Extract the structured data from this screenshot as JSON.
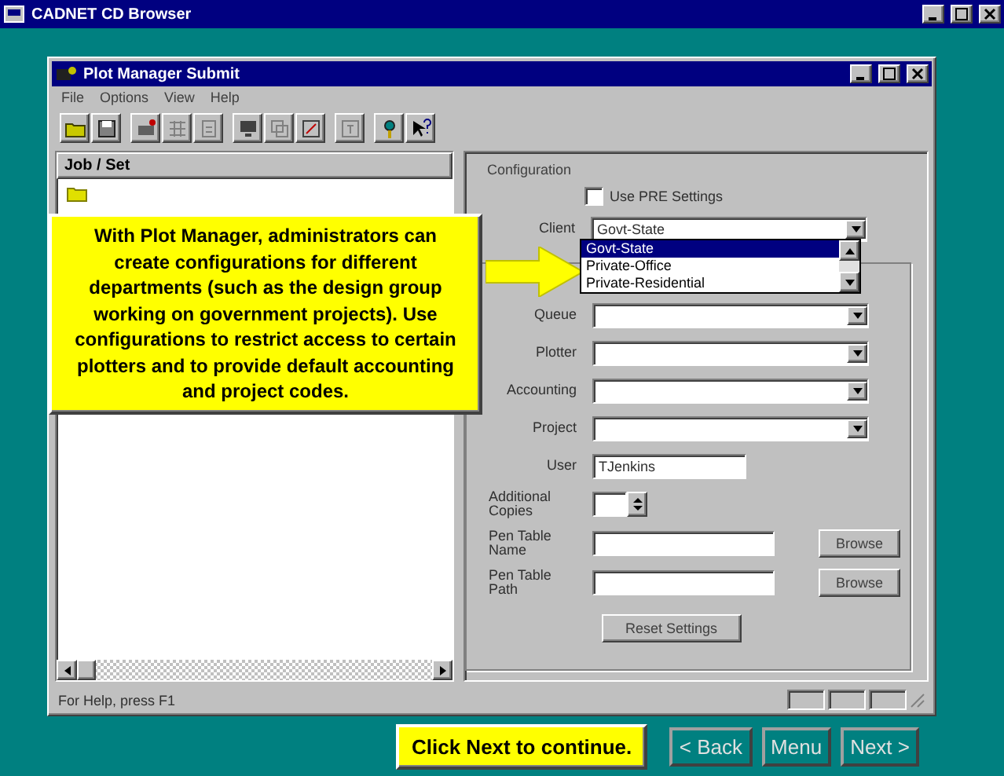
{
  "window": {
    "title": "CADNET CD Browser"
  },
  "dialog": {
    "title": "Plot Manager Submit",
    "menu": [
      "File",
      "Options",
      "View",
      "Help"
    ],
    "job_list": {
      "header": "Job / Set"
    },
    "configuration": {
      "heading": "Configuration",
      "use_pre_settings": {
        "label": "Use PRE Settings",
        "checked": false
      },
      "client": {
        "label": "Client",
        "value": "Govt-State"
      },
      "client_options": [
        {
          "label": "Govt-State",
          "selected": true
        },
        {
          "label": "Private-Office",
          "selected": false
        },
        {
          "label": "Private-Residential",
          "selected": false
        }
      ]
    },
    "fields": [
      {
        "kind": "combo",
        "label": "Queue"
      },
      {
        "kind": "combo",
        "label": "Plotter"
      },
      {
        "kind": "combo",
        "label": "Accounting"
      },
      {
        "kind": "combo",
        "label": "Project"
      },
      {
        "kind": "text",
        "label": "User",
        "value": "TJenkins"
      },
      {
        "kind": "spin",
        "label": "Additional Copies"
      },
      {
        "kind": "browse",
        "label": "Pen Table Name",
        "button": "Browse"
      },
      {
        "kind": "browse",
        "label": "Pen Table Path",
        "button": "Browse"
      }
    ],
    "reset_button": "Reset Settings",
    "status_bar": {
      "text": "For Help, press F1"
    }
  },
  "callout": {
    "text": "With Plot Manager, administrators can create configurations for different departments (such as the design group working on government projects).  Use configurations to restrict access to certain plotters and to provide default accounting and project codes."
  },
  "instruction": "Click Next to continue.",
  "nav_buttons": [
    "< Back",
    "Menu",
    "Next >"
  ]
}
